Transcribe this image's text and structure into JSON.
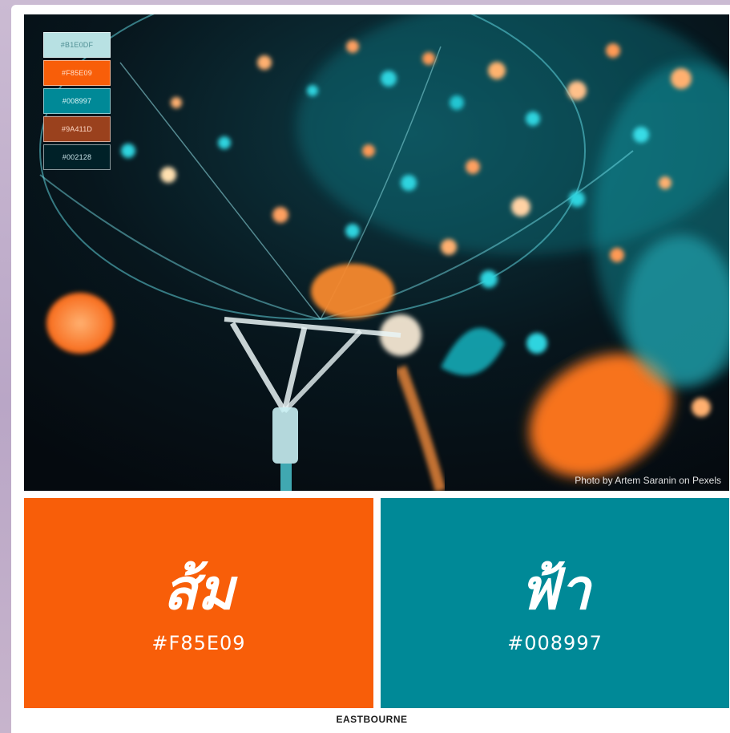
{
  "palette": {
    "swatches": [
      {
        "label": "#B1E0DF",
        "color": "#b8e1e3",
        "text": "#4f8f94"
      },
      {
        "label": "#F85E09",
        "color": "#f85e09",
        "text": "#ffe0cc"
      },
      {
        "label": "#008997",
        "color": "#008997",
        "text": "#dff6f8"
      },
      {
        "label": "#9A411D",
        "color": "#9a411d",
        "text": "#ffd8c6"
      },
      {
        "label": "#002128",
        "color": "#002128",
        "text": "#c9e3e8"
      }
    ]
  },
  "photo": {
    "credit": "Photo by Artem Saranin on Pexels"
  },
  "colors": {
    "orange": {
      "name": "ส้ม",
      "hex": "#F85E09",
      "fill": "#f85e09"
    },
    "blue": {
      "name": "ฟ้า",
      "hex": "#008997",
      "fill": "#008997"
    }
  },
  "brand": {
    "label": "EASTBOURNE"
  }
}
